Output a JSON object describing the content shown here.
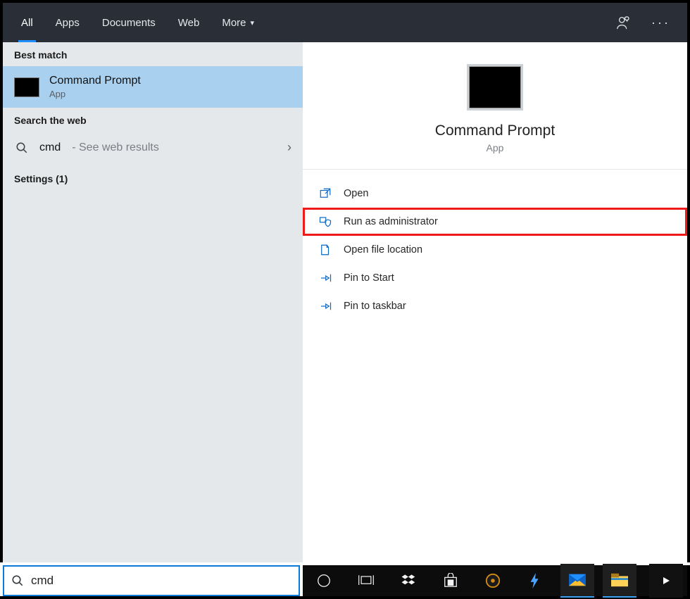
{
  "tabs": {
    "all": "All",
    "apps": "Apps",
    "documents": "Documents",
    "web": "Web",
    "more": "More"
  },
  "left": {
    "best_match": "Best match",
    "result_title": "Command Prompt",
    "result_subtitle": "App",
    "search_web_header": "Search the web",
    "web_query": "cmd",
    "web_hint": " - See web results",
    "settings_label": "Settings (1)"
  },
  "preview": {
    "title": "Command Prompt",
    "subtitle": "App"
  },
  "actions": {
    "open": "Open",
    "run_admin": "Run as administrator",
    "open_location": "Open file location",
    "pin_start": "Pin to Start",
    "pin_taskbar": "Pin to taskbar"
  },
  "search": {
    "value": "cmd",
    "placeholder": ""
  }
}
